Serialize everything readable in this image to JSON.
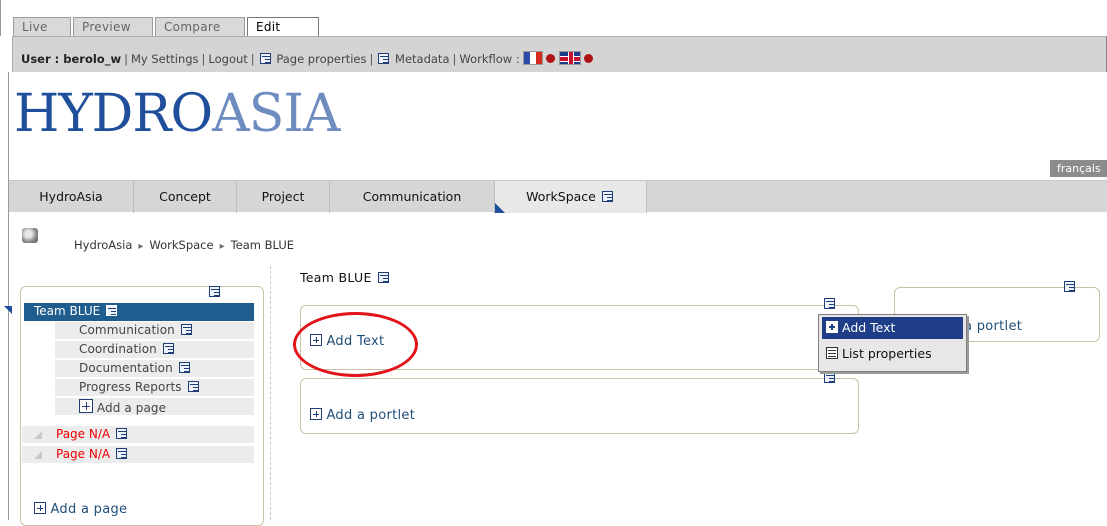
{
  "mode_tabs": [
    {
      "label": "Live",
      "active": false
    },
    {
      "label": "Preview",
      "active": false
    },
    {
      "label": "Compare",
      "active": false
    },
    {
      "label": "Edit",
      "active": true
    }
  ],
  "userbar": {
    "user_label": "User : berolo_w",
    "my_settings": "My Settings",
    "logout": "Logout",
    "page_properties": "Page properties",
    "metadata": "Metadata",
    "workflow": "Workflow :"
  },
  "logo": {
    "part1": "HYDRO",
    "part2": "ASIA"
  },
  "language_tab": "français",
  "nav_tabs": [
    {
      "label": "HydroAsia"
    },
    {
      "label": "Concept"
    },
    {
      "label": "Project"
    },
    {
      "label": "Communication"
    },
    {
      "label": "WorkSpace"
    }
  ],
  "breadcrumb": [
    "HydroAsia",
    "WorkSpace",
    "Team BLUE"
  ],
  "tree": {
    "active": "Team BLUE",
    "children": [
      "Communication",
      "Coordination",
      "Documentation",
      "Progress Reports"
    ],
    "add_child": "Add a page",
    "siblings": [
      "Page N/A",
      "Page N/A"
    ],
    "add_page": "Add a page"
  },
  "main": {
    "title": "Team BLUE",
    "add_text": "Add Text",
    "add_portlet": "Add a portlet",
    "right_partial": "a portlet"
  },
  "context_menu": {
    "add_text": "Add Text",
    "list_properties": "List properties"
  },
  "colors": {
    "brand_blue": "#1f4e9b",
    "highlight_red": "#e1141a",
    "missing_page_red": "#ee0000"
  }
}
